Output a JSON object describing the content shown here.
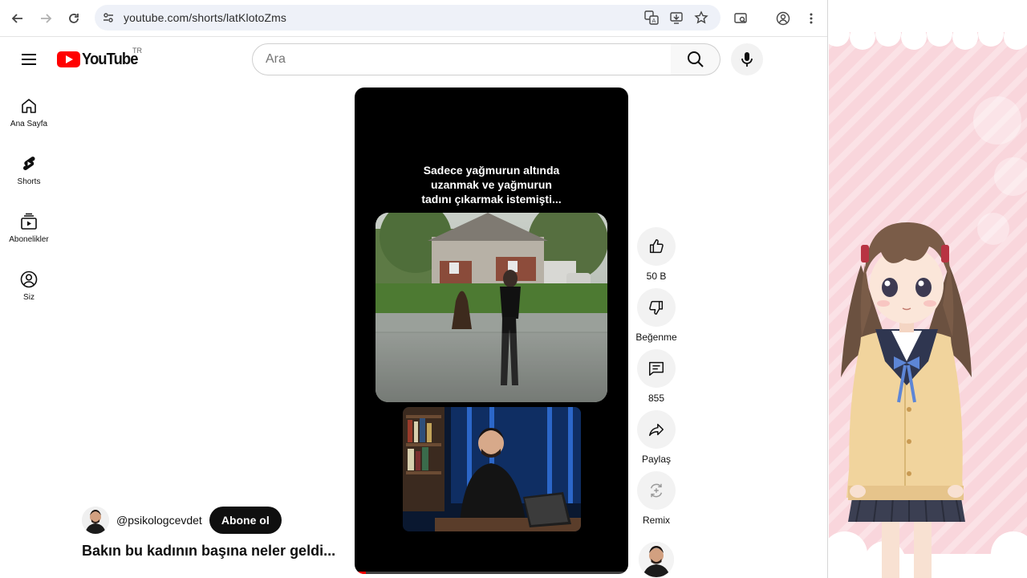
{
  "browser": {
    "url": "youtube.com/shorts/latKlotoZms"
  },
  "header": {
    "logo_text": "YouTube",
    "country_code": "TR",
    "search_placeholder": "Ara"
  },
  "sidebar": {
    "items": [
      {
        "label": "Ana Sayfa",
        "icon": "home-icon"
      },
      {
        "label": "Shorts",
        "icon": "shorts-icon"
      },
      {
        "label": "Abonelikler",
        "icon": "subscriptions-icon"
      },
      {
        "label": "Siz",
        "icon": "account-icon"
      }
    ]
  },
  "video": {
    "caption_lines": [
      "Sadece yağmurun altında",
      "uzanmak ve yağmurun",
      "tadını çıkarmak istemişti..."
    ],
    "progress": 0.04
  },
  "channel": {
    "handle": "@psikologcevdet",
    "subscribe_label": "Abone ol",
    "title": "Bakın bu kadının başına neler geldi..."
  },
  "actions": {
    "like": "50 B",
    "dislike": "Beğenme",
    "comments": "855",
    "share": "Paylaş",
    "remix": "Remix"
  },
  "colors": {
    "brand_red": "#ff0000",
    "subscribe_bg": "#0f0f0f",
    "panel_pink": "#f9d6dc"
  }
}
